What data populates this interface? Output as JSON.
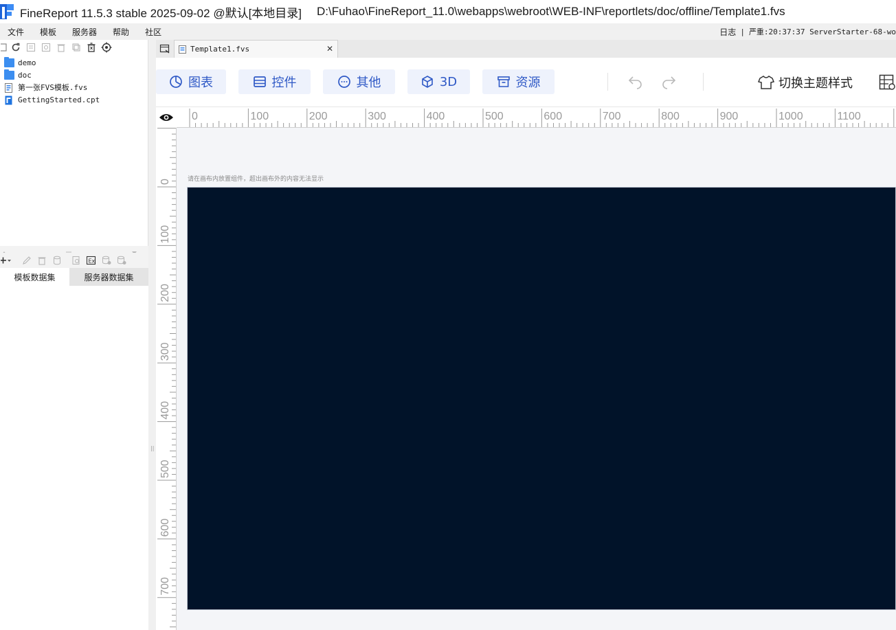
{
  "window": {
    "title": "FineReport 11.5.3 stable 2025-09-02 @默认[本地目录]",
    "path": "D:\\Fuhao\\FineReport_11.0\\webapps\\webroot\\WEB-INF\\reportlets/doc/offline/Template1.fvs"
  },
  "menu": {
    "items": [
      "文件",
      "模板",
      "服务器",
      "帮助",
      "社区"
    ],
    "log_label": "日志",
    "status": "严重:20:37:37 ServerStarter-68-wo"
  },
  "file_tree": {
    "items": [
      {
        "label": "demo",
        "icon": "folder-icon"
      },
      {
        "label": "doc",
        "icon": "folder-icon"
      },
      {
        "label": "第一张FVS模板.fvs",
        "icon": "fvs-file-icon"
      },
      {
        "label": "GettingStarted.cpt",
        "icon": "cpt-file-icon"
      }
    ]
  },
  "dataset_tabs": {
    "template": "模板数据集",
    "server": "服务器数据集"
  },
  "tabs": {
    "active": "Template1.fvs"
  },
  "toolbar": {
    "chart": "图表",
    "widget": "控件",
    "other": "其他",
    "threed": "3D",
    "resource": "资源",
    "theme": "切换主题样式"
  },
  "ruler": {
    "h_labels": [
      "0",
      "100",
      "200",
      "300",
      "400",
      "500",
      "600",
      "700",
      "800",
      "900",
      "1000",
      "1100"
    ],
    "v_labels": [
      "0",
      "100",
      "200",
      "300",
      "400",
      "500",
      "600",
      "700"
    ]
  },
  "canvas": {
    "hint": "请在画布内放置组件，超出画布外的内容无法显示",
    "background": "#011329"
  },
  "colors": {
    "accent": "#2f59c6",
    "button_bg": "#eef2fc",
    "folder": "#3c8ef0"
  }
}
